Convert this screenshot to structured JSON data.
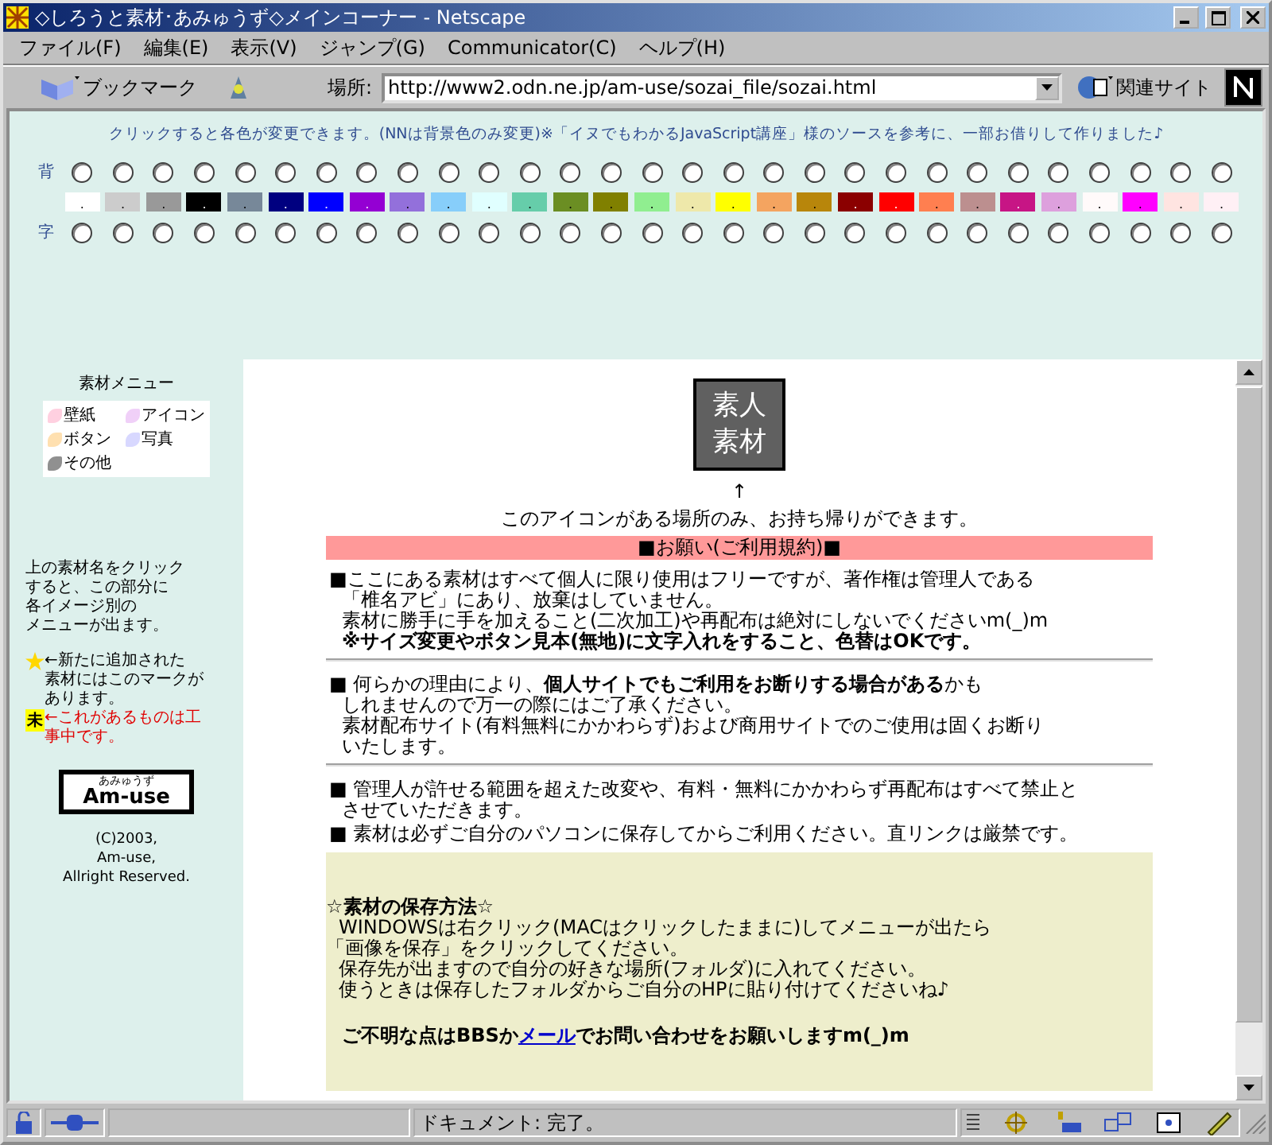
{
  "window": {
    "title": "◇しろうと素材･あみゅうず◇メインコーナー - Netscape"
  },
  "menu": [
    "ファイル(F)",
    "編集(E)",
    "表示(V)",
    "ジャンプ(G)",
    "Communicator(C)",
    "ヘルプ(H)"
  ],
  "toolbar": {
    "bookmarks_label": "ブックマーク",
    "location_label": "場所:",
    "url": "http://www2.odn.ne.jp/am-use/sozai_file/sozai.html",
    "related_label": "関連サイト"
  },
  "palette": {
    "caption": "クリックすると各色が変更できます。(NNは背景色のみ変更)※「イヌでもわかるJavaScript講座」様のソースを参考に、一部お借りして作りました♪",
    "bg_label": "背",
    "text_label": "字",
    "swatches": [
      {
        "color": "#ffffff",
        "label": ".",
        "bg_selected": false,
        "text_selected": false
      },
      {
        "color": "#cccccc",
        "label": ".",
        "bg_selected": false,
        "text_selected": false
      },
      {
        "color": "#999999",
        "label": ".",
        "bg_selected": false,
        "text_selected": false
      },
      {
        "color": "#000000",
        "label": ".",
        "bg_selected": false,
        "text_selected": false
      },
      {
        "color": "#778899",
        "label": ".",
        "bg_selected": false,
        "text_selected": false
      },
      {
        "color": "#000080",
        "label": ".",
        "bg_selected": false,
        "text_selected": false
      },
      {
        "color": "#0000ff",
        "label": ".",
        "bg_selected": false,
        "text_selected": false
      },
      {
        "color": "#9400d3",
        "label": ".",
        "bg_selected": false,
        "text_selected": false
      },
      {
        "color": "#9370db",
        "label": ".",
        "bg_selected": false,
        "text_selected": false
      },
      {
        "color": "#87cefa",
        "label": ".",
        "bg_selected": false,
        "text_selected": false
      },
      {
        "color": "#e0ffff",
        "label": ".",
        "bg_selected": false,
        "text_selected": false
      },
      {
        "color": "#66cdaa",
        "label": ".",
        "bg_selected": false,
        "text_selected": false
      },
      {
        "color": "#6b8e23",
        "label": ".",
        "bg_selected": false,
        "text_selected": false
      },
      {
        "color": "#808000",
        "label": ".",
        "bg_selected": false,
        "text_selected": false
      },
      {
        "color": "#90ee90",
        "label": ".",
        "bg_selected": false,
        "text_selected": false
      },
      {
        "color": "#eee8aa",
        "label": ".",
        "bg_selected": false,
        "text_selected": false
      },
      {
        "color": "#ffff00",
        "label": ".",
        "bg_selected": false,
        "text_selected": false
      },
      {
        "color": "#f4a460",
        "label": ".",
        "bg_selected": false,
        "text_selected": false
      },
      {
        "color": "#b8860b",
        "label": ".",
        "bg_selected": false,
        "text_selected": false
      },
      {
        "color": "#8b0000",
        "label": ".",
        "bg_selected": false,
        "text_selected": false
      },
      {
        "color": "#ff0000",
        "label": ".",
        "bg_selected": false,
        "text_selected": false
      },
      {
        "color": "#ff7f50",
        "label": ".",
        "bg_selected": false,
        "text_selected": false
      },
      {
        "color": "#bc8f8f",
        "label": ".",
        "bg_selected": false,
        "text_selected": false
      },
      {
        "color": "#c71585",
        "label": ".",
        "bg_selected": false,
        "text_selected": false
      },
      {
        "color": "#dda0dd",
        "label": ".",
        "bg_selected": false,
        "text_selected": false
      },
      {
        "color": "#fffafa",
        "label": ".",
        "bg_selected": false,
        "text_selected": false
      },
      {
        "color": "#ff00ff",
        "label": ".",
        "bg_selected": false,
        "text_selected": false
      },
      {
        "color": "#ffe4e1",
        "label": ".",
        "bg_selected": false,
        "text_selected": false
      },
      {
        "color": "#fff0f5",
        "label": ".",
        "bg_selected": false,
        "text_selected": false
      }
    ]
  },
  "sidebar": {
    "menu_title": "素材メニュー",
    "menu_items": [
      {
        "label": "壁紙",
        "color": "#ffd0e0"
      },
      {
        "label": "アイコン",
        "color": "#f0d0f8"
      },
      {
        "label": "ボタン",
        "color": "#ffe0b0"
      },
      {
        "label": "写真",
        "color": "#d8d8ff"
      },
      {
        "label": "その他",
        "color": "#909090"
      }
    ],
    "help_lines": [
      "上の素材名をクリック",
      "すると、この部分に",
      "各イメージ別の",
      "メニューが出ます。"
    ],
    "new_lines": [
      "←新たに追加された",
      "素材にはこのマークが",
      "あります。"
    ],
    "wip_badge": "未",
    "wip_lines": [
      "←これがあるものは工",
      "事中です。"
    ],
    "logo_small": "あみゅうず",
    "logo_big": "Am-use",
    "copyright": [
      "(C)2003,",
      "Am-use,",
      "Allright Reserved."
    ]
  },
  "main": {
    "icon_text": [
      "素人",
      "素材"
    ],
    "arrow": "↑",
    "icon_note": "このアイコンがある場所のみ、お持ち帰りができます。",
    "terms_title": "■お願い(ご利用規約)■",
    "sections": [
      {
        "lines": [
          "■ここにある素材はすべて個人に限り使用はフリーですが、著作権は管理人である",
          "「椎名アビ」にあり、放棄はしていません。",
          "素材に勝手に手を加えること(二次加工)や再配布は絶対にしないでくださいm(_)m",
          "**※サイズ変更やボタン見本(無地)に文字入れをすること、色替はOKです。**"
        ]
      },
      {
        "lines": [
          "■ 何らかの理由により、**個人サイトでもご利用をお断りする場合がある**かも",
          "しれませんので万一の際にはご了承ください。",
          "素材配布サイト(有料無料にかかわらず)および商用サイトでのご使用は固くお断り",
          "いたします。"
        ]
      },
      {
        "lines": [
          "■ 管理人が許せる範囲を超えた改変や、有料・無料にかかわらず再配布はすべて禁止と",
          "させていただきます。"
        ]
      },
      {
        "lines": [
          "■ 素材は必ずご自分のパソコンに保存してからご利用ください。直リンクは厳禁です。"
        ]
      }
    ],
    "save_box": {
      "title": "☆素材の保存方法☆",
      "lines": [
        "WINDOWSは右クリック(MACはクリックしたままに)してメニューが出たら",
        "「画像を保存」をクリックしてください。",
        "保存先が出ますので自分の好きな場所(フォルダ)に入れてください。",
        "使うときは保存したフォルダからご自分のHPに貼り付けてくださいね♪"
      ],
      "contact_before": "ご不明な点はBBSか",
      "contact_link": "メール",
      "contact_after": "でお問い合わせをお願いしますm(_)m"
    }
  },
  "status_bar": {
    "text": "ドキュメント: 完了。"
  }
}
